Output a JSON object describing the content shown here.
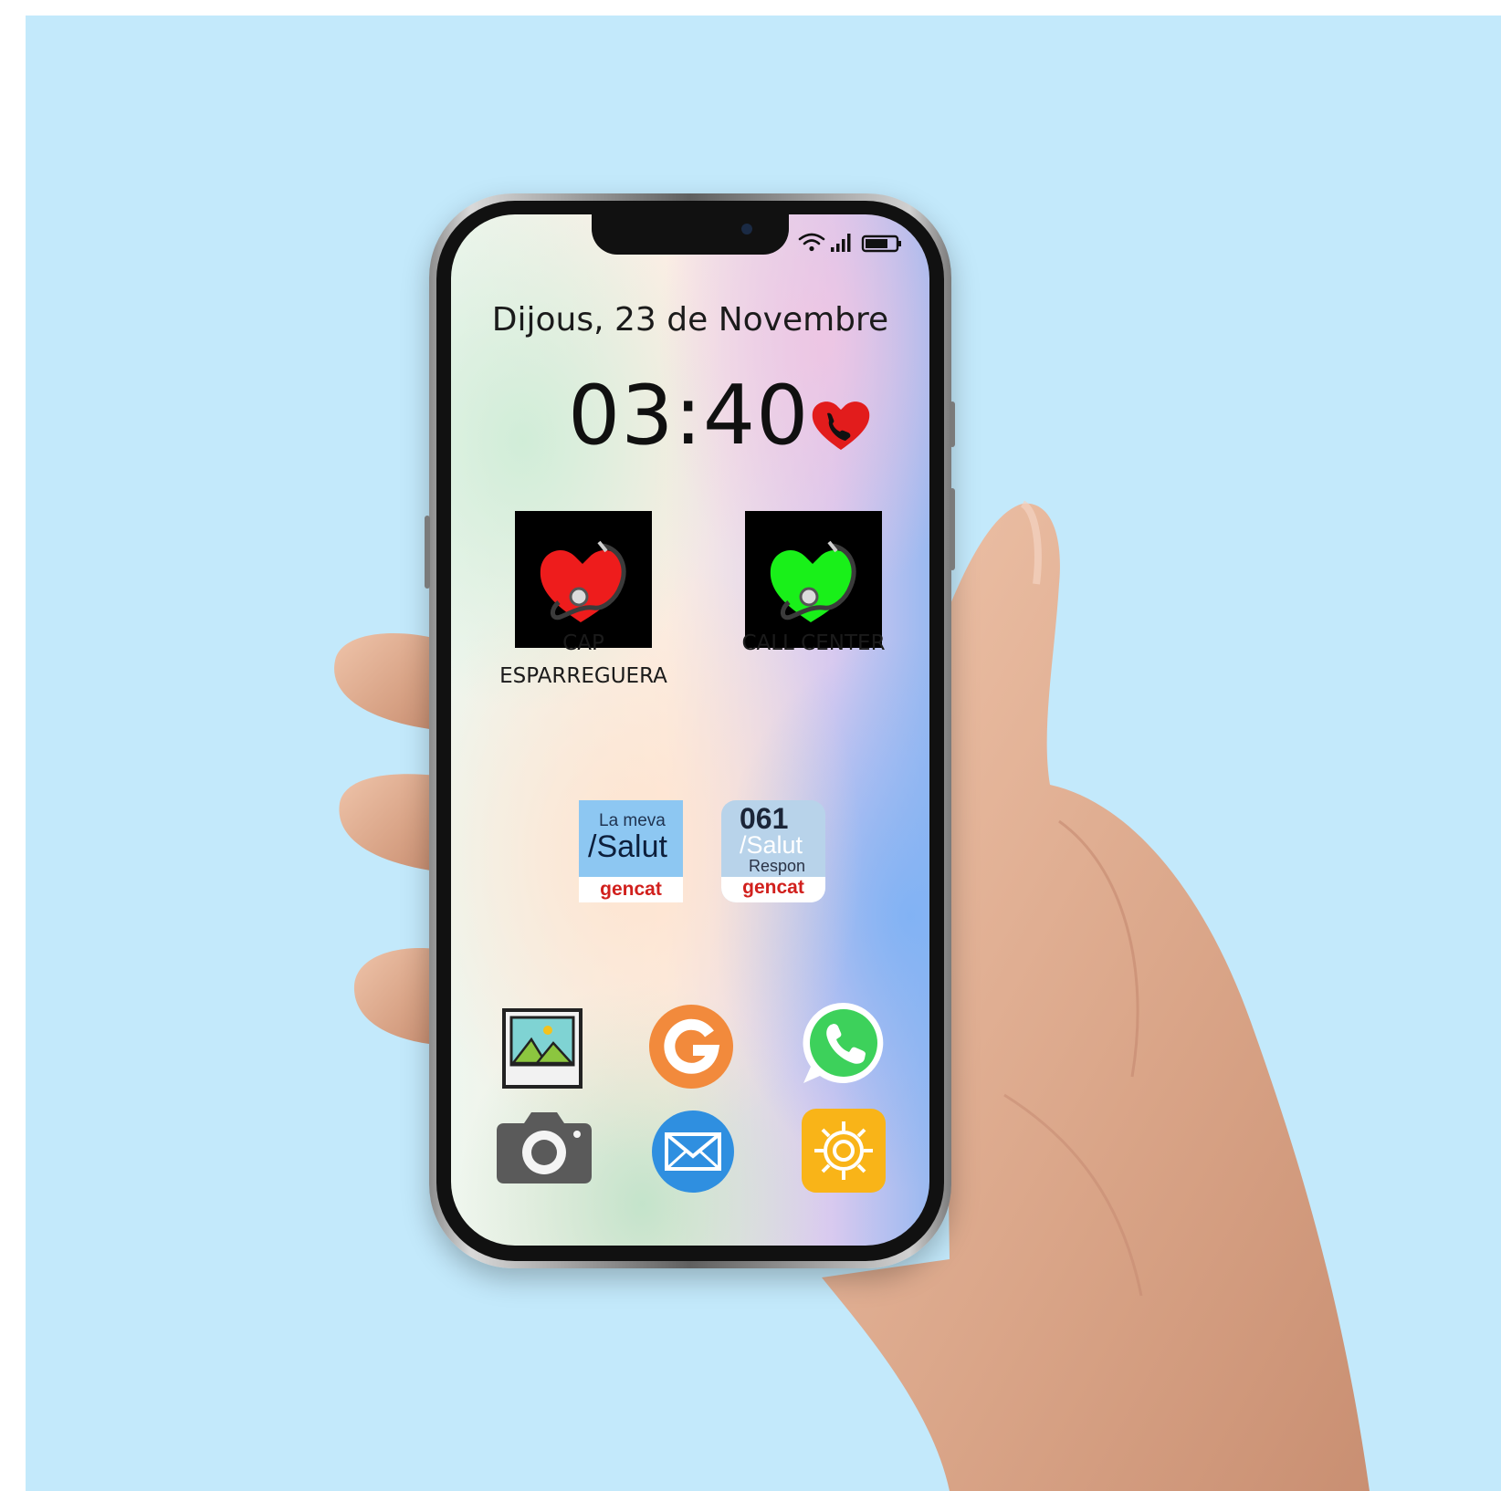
{
  "lockscreen": {
    "date": "Dijous, 23 de Novembre",
    "time": "03:40"
  },
  "contacts": [
    {
      "label": "CAP ESPARREGUERA",
      "heart_color": "#ee1c1c"
    },
    {
      "label": "CALL CENTER",
      "heart_color": "#19f019"
    }
  ],
  "health_apps": {
    "la_meva_salut": {
      "line1": "La meva",
      "line2": "/Salut",
      "brand": "gencat"
    },
    "salut_respon": {
      "line1": "061",
      "line2": "/Salut",
      "line3": "Respon",
      "brand": "gencat"
    }
  },
  "dock_icons": [
    "gallery-icon",
    "google-icon",
    "whatsapp-icon",
    "camera-icon",
    "mail-icon",
    "settings-icon"
  ],
  "colors": {
    "background": "#c3e9fb",
    "google": "#f28a3c",
    "whatsapp": "#3dd15b",
    "mail": "#2f8fe0",
    "settings": "#f9b418",
    "camera": "#5a5a5a"
  }
}
